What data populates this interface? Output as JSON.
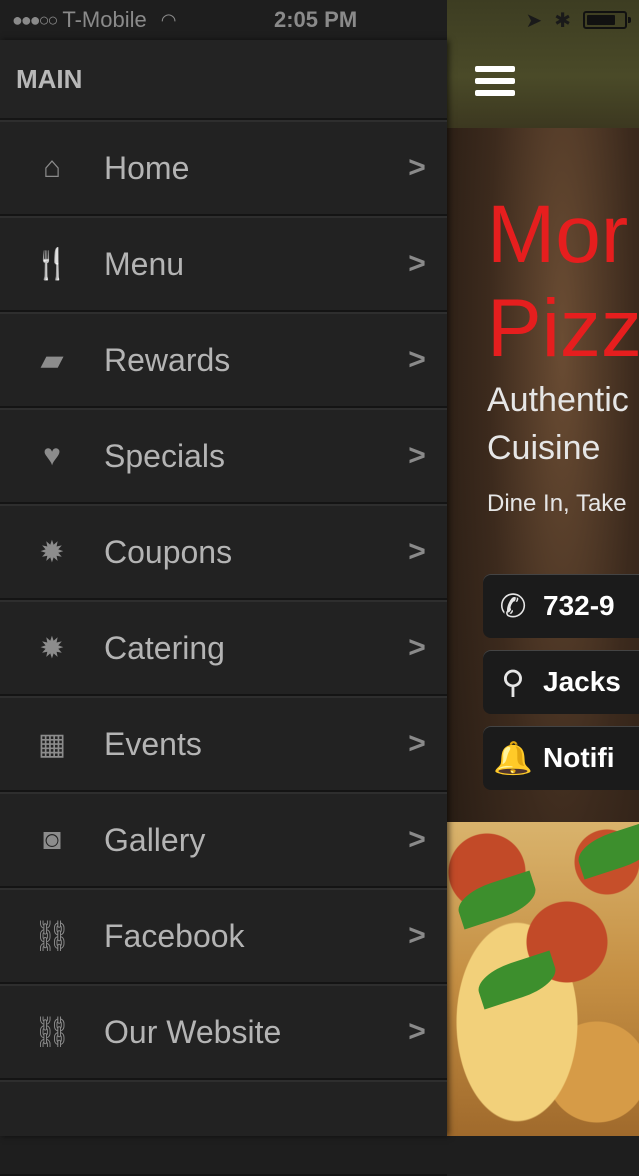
{
  "status_bar": {
    "carrier": "T-Mobile",
    "signal": "●●●○○",
    "time": "2:05 PM"
  },
  "drawer": {
    "header": "MAIN",
    "items": [
      {
        "label": "Home",
        "icon": "home-icon",
        "glyph": "⌂"
      },
      {
        "label": "Menu",
        "icon": "fork-knife-icon",
        "glyph": "🍴"
      },
      {
        "label": "Rewards",
        "icon": "ticket-icon",
        "glyph": "▰"
      },
      {
        "label": "Specials",
        "icon": "heart-icon",
        "glyph": "♥"
      },
      {
        "label": "Coupons",
        "icon": "badge-icon",
        "glyph": "✹"
      },
      {
        "label": "Catering",
        "icon": "badge-icon",
        "glyph": "✹"
      },
      {
        "label": "Events",
        "icon": "calendar-icon",
        "glyph": "▦"
      },
      {
        "label": "Gallery",
        "icon": "camera-icon",
        "glyph": "◙"
      },
      {
        "label": "Facebook",
        "icon": "link-icon",
        "glyph": "⛓"
      },
      {
        "label": "Our Website",
        "icon": "link-icon",
        "glyph": "⛓"
      }
    ]
  },
  "content": {
    "title": "Mor\nPizz",
    "subtitle": "Authentic\nCuisine",
    "note": "Dine In, Take",
    "actions": [
      {
        "label": "732-9",
        "icon": "phone-icon",
        "glyph": "✆"
      },
      {
        "label": "Jacks",
        "icon": "map-pin-icon",
        "glyph": "⚲"
      },
      {
        "label": "Notifi",
        "icon": "bell-icon",
        "glyph": "🔔"
      }
    ]
  },
  "colors": {
    "title_red": "#e61e1e",
    "drawer_bg": "#222222"
  }
}
